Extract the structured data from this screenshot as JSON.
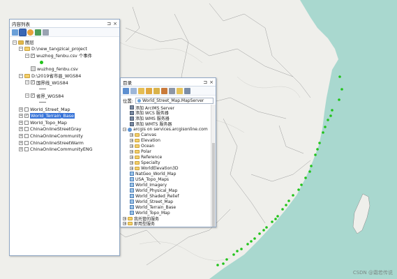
{
  "toc": {
    "title": "内容列表",
    "items": [
      {
        "label": "图层",
        "level": 0,
        "expand": "−",
        "kind": "layers"
      },
      {
        "label": "D:\\new_tangzicai_project",
        "level": 1,
        "expand": "−",
        "kind": "folder"
      },
      {
        "label": "wuzhog_fenbu.csv 个事件",
        "level": 2,
        "expand": "−",
        "kind": "check",
        "checked": true
      },
      {
        "label": "",
        "level": 3,
        "expand": "",
        "kind": "dot"
      },
      {
        "label": "wuzhog_fenbu.csv",
        "level": 2,
        "expand": "",
        "kind": "table"
      },
      {
        "label": "D:\\2019省市县_WGS84",
        "level": 1,
        "expand": "−",
        "kind": "folder"
      },
      {
        "label": "国界线_WGS84",
        "level": 2,
        "expand": "−",
        "kind": "check",
        "checked": true
      },
      {
        "label": "",
        "level": 3,
        "expand": "",
        "kind": "line"
      },
      {
        "label": "省界_WGS84",
        "level": 2,
        "expand": "−",
        "kind": "check",
        "checked": true
      },
      {
        "label": "",
        "level": 3,
        "expand": "",
        "kind": "line"
      },
      {
        "label": "World_Street_Map",
        "level": 1,
        "expand": "+",
        "kind": "check",
        "checked": false
      },
      {
        "label": "World_Terrain_Base",
        "level": 1,
        "expand": "+",
        "kind": "check",
        "checked": true,
        "selected": true
      },
      {
        "label": "World_Topo_Map",
        "level": 1,
        "expand": "+",
        "kind": "check",
        "checked": false
      },
      {
        "label": "ChinaOnlineStreetGray",
        "level": 1,
        "expand": "+",
        "kind": "check",
        "checked": false
      },
      {
        "label": "ChinaOnlineCommunity",
        "level": 1,
        "expand": "+",
        "kind": "check",
        "checked": false
      },
      {
        "label": "ChinaOnlineStreetWarm",
        "level": 1,
        "expand": "+",
        "kind": "check",
        "checked": false
      },
      {
        "label": "ChinaOnlineCommunityENG",
        "level": 1,
        "expand": "+",
        "kind": "check",
        "checked": false
      }
    ]
  },
  "catalog": {
    "title": "目录",
    "location_label": "位置:",
    "location_value": "World_Street_Map.MapServer",
    "items": [
      {
        "label": "添加 ArcIMS Server",
        "level": 1,
        "expand": "",
        "icon": "server"
      },
      {
        "label": "添加 WCS 服务器",
        "level": 1,
        "expand": "",
        "icon": "server"
      },
      {
        "label": "添加 WMS 服务器",
        "level": 1,
        "expand": "",
        "icon": "server"
      },
      {
        "label": "添加 WMTS 服务器",
        "level": 1,
        "expand": "",
        "icon": "server"
      },
      {
        "label": "arcgis on services.arcgisonline.com",
        "level": 0,
        "expand": "−",
        "icon": "globe"
      },
      {
        "label": "Canvas",
        "level": 1,
        "expand": "+",
        "icon": "folder"
      },
      {
        "label": "Elevation",
        "level": 1,
        "expand": "+",
        "icon": "folder"
      },
      {
        "label": "Ocean",
        "level": 1,
        "expand": "+",
        "icon": "folder"
      },
      {
        "label": "Polar",
        "level": 1,
        "expand": "+",
        "icon": "folder"
      },
      {
        "label": "Reference",
        "level": 1,
        "expand": "+",
        "icon": "folder"
      },
      {
        "label": "Specialty",
        "level": 1,
        "expand": "+",
        "icon": "folder"
      },
      {
        "label": "WorldElevation3D",
        "level": 1,
        "expand": "+",
        "icon": "folder"
      },
      {
        "label": "NatGeo_World_Map",
        "level": 1,
        "expand": "",
        "icon": "mapservice"
      },
      {
        "label": "USA_Topo_Maps",
        "level": 1,
        "expand": "",
        "icon": "mapservice"
      },
      {
        "label": "World_Imagery",
        "level": 1,
        "expand": "",
        "icon": "mapservice"
      },
      {
        "label": "World_Physical_Map",
        "level": 1,
        "expand": "",
        "icon": "mapservice"
      },
      {
        "label": "World_Shaded_Relief",
        "level": 1,
        "expand": "",
        "icon": "mapservice"
      },
      {
        "label": "World_Street_Map",
        "level": 1,
        "expand": "",
        "icon": "mapservice"
      },
      {
        "label": "World_Terrain_Base",
        "level": 1,
        "expand": "",
        "icon": "mapservice"
      },
      {
        "label": "World_Topo_Map",
        "level": 1,
        "expand": "",
        "icon": "mapservice"
      },
      {
        "label": "我托管的服务",
        "level": 0,
        "expand": "+",
        "icon": "folder"
      },
      {
        "label": "即用型服务",
        "level": 0,
        "expand": "+",
        "icon": "folder"
      }
    ]
  },
  "watermark": "CSDN @霜若传说",
  "colors": {
    "sea": "#a9d8cf",
    "land": "#f0f0ec",
    "points": "#22c31b",
    "selection": "#3874d8"
  }
}
